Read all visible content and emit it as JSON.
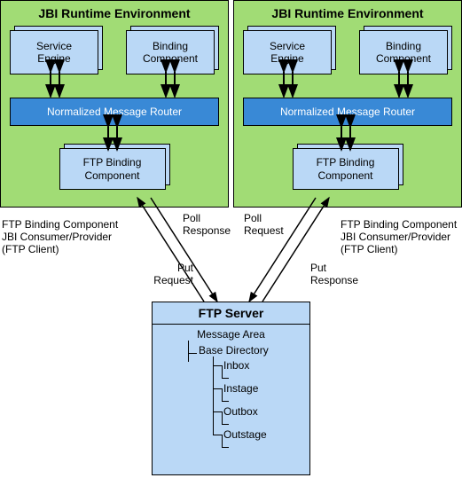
{
  "jbi": {
    "title": "JBI Runtime Environment",
    "service_engine": "Service\nEngine",
    "binding_component": "Binding\nComponent",
    "nmr": "Normalized Message Router",
    "ftp_bc": "FTP Binding\nComponent"
  },
  "ftp_server": {
    "title": "FTP Server",
    "area": "Message Area",
    "base": "Base Directory",
    "dirs": [
      "Inbox",
      "Instage",
      "Outbox",
      "Outstage"
    ]
  },
  "labels": {
    "client_left": "FTP Binding Component\nJBI Consumer/Provider\n(FTP Client)",
    "client_right": "FTP Binding Component\nJBI Consumer/Provider\n(FTP Client)",
    "poll_response": "Poll\nResponse",
    "poll_request": "Poll\nRequest",
    "put_request": "Put\nRequest",
    "put_response": "Put\nResponse"
  },
  "colors": {
    "green": "#a1dc75",
    "light_blue": "#bad8f6",
    "dark_blue": "#3989d6"
  }
}
